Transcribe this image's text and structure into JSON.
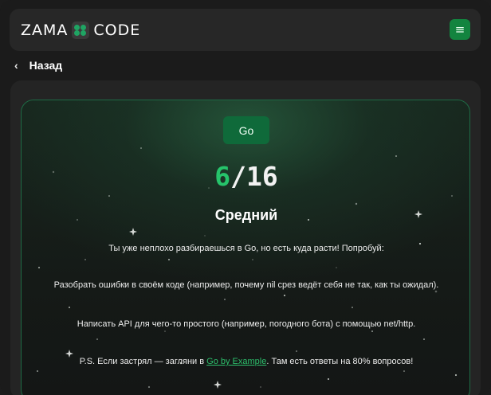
{
  "header": {
    "logo_left": "ZAMA",
    "logo_right": "CODE",
    "menu_glyph": "≡",
    "menu_icon": "hamburger-menu-icon"
  },
  "nav": {
    "back_glyph": "‹",
    "back_label": "Назад"
  },
  "result": {
    "language_badge": "Go",
    "score_current": "6",
    "score_total": "/16",
    "level_title": "Средний",
    "intro": "Ты уже неплохо разбираешься в Go, но есть куда расти! Попробуй:",
    "tip_1": "Разобрать ошибки в своём коде (например, почему nil срез ведёт себя не так, как ты ожидал).",
    "tip_2": "Написать API для чего-то простого (например, погодного бота) с помощью net/http.",
    "ps_before": "P.S. Если застрял — загляни в ",
    "ps_link": "Go by Example",
    "ps_after": ". Там есть ответы на 80% вопросов!"
  },
  "colors": {
    "accent": "#26c46b",
    "badge_bg": "#0f6a3a",
    "card_border": "#1e6b45",
    "page_bg": "#1b1b1b"
  }
}
